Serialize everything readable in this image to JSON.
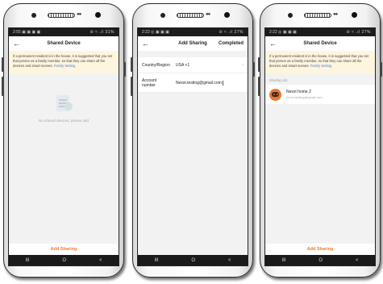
{
  "screens": [
    {
      "status": {
        "time": "2:55",
        "left_icons": "▣ ▣ ▣ ▣",
        "right": "⊘ ≈ .ıl 31%"
      },
      "nav": {
        "title": "Shared Device",
        "back": "←"
      },
      "notice": {
        "text": "If a permanent resident is in the house, it is suggested that you set that person as a family member, so that they can share all the devices and smart scenes.",
        "link": "Family Setting"
      },
      "empty_text": "No shared devices, please add",
      "bottom_action": "Add Sharing"
    },
    {
      "status": {
        "time": "2:22",
        "left_icons": "◎ ▣ ▣ ▣",
        "right": "⊘ ≈ .ıl 27%"
      },
      "nav": {
        "title": "Add Sharing",
        "back": "←",
        "action": "Completed"
      },
      "form": {
        "region_label": "Country/Region",
        "region_value": "USA +1",
        "account_label_line1": "Account",
        "account_label_line2": "number",
        "account_value": "Nexxt.testing@gmail.com"
      }
    },
    {
      "status": {
        "time": "2:22",
        "left_icons": "◎ ▣ ▣ ▣",
        "right": "⊘ ≈ .ıl 27%"
      },
      "nav": {
        "title": "Shared Device",
        "back": "←"
      },
      "notice": {
        "text": "If a permanent resident is in the house, it is suggested that you set that person as a family member, so that they can share all the devices and smart scenes.",
        "link": "Family Setting"
      },
      "section_label": "Sharing List",
      "share_item": {
        "name": "Nexxt home 2",
        "email": "nexxt.testing@gmail.com"
      },
      "bottom_action": "Add Sharing"
    }
  ],
  "system_nav": {
    "recent": "III",
    "home": "O",
    "back": "<"
  },
  "colors": {
    "accent": "#f07a2a",
    "link": "#4a7fd4",
    "notice_bg": "#fdf5dd"
  }
}
